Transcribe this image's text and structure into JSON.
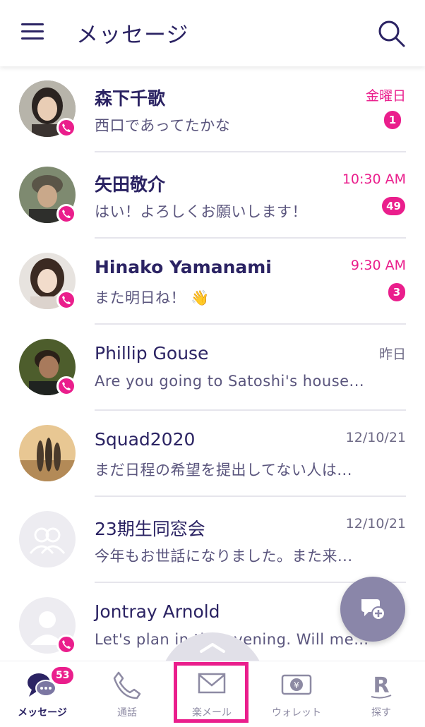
{
  "header": {
    "title": "メッセージ"
  },
  "conversations": [
    {
      "name": "森下千歌",
      "preview": "西口であってたかな",
      "time": "金曜日",
      "unread": "1",
      "bold": true,
      "call_badge": true
    },
    {
      "name": "矢田敬介",
      "preview": "はい！よろしくお願いします！",
      "time": "10:30 AM",
      "unread": "49",
      "bold": true,
      "call_badge": true
    },
    {
      "name": "Hinako Yamanami",
      "preview": "また明日ね！ 👋",
      "time": "9:30 AM",
      "unread": "3",
      "bold": true,
      "call_badge": true
    },
    {
      "name": "Phillip Gouse",
      "preview": "Are you going to Satoshi's house...",
      "time": "昨日",
      "unread": "",
      "bold": false,
      "call_badge": true
    },
    {
      "name": "Squad2020",
      "preview": "まだ日程の希望を提出してない人は...",
      "time": "12/10/21",
      "unread": "",
      "bold": false,
      "call_badge": false
    },
    {
      "name": "23期生同窓会",
      "preview": "今年もお世話になりました。また来...",
      "time": "12/10/21",
      "unread": "",
      "bold": false,
      "call_badge": false
    },
    {
      "name": "Jontray Arnold",
      "preview": "Let's plan in the evening. Will mee...",
      "time": "",
      "unread": "",
      "bold": false,
      "call_badge": true
    }
  ],
  "bottom_nav": {
    "messages_label": "メッセージ",
    "messages_badge": "53",
    "calls_label": "通話",
    "rakumail_label": "楽メール",
    "wallet_label": "ウォレット",
    "search_label": "探す"
  },
  "colors": {
    "accent": "#ea1e8c",
    "text": "#2b2363",
    "fab": "#8a86a9"
  },
  "icons": [
    "menu-icon",
    "search-icon",
    "phone-icon",
    "new-chat-icon",
    "chevron-up-icon",
    "chat-bubbles-icon",
    "mail-icon",
    "wallet-icon",
    "rakuten-r-icon"
  ]
}
